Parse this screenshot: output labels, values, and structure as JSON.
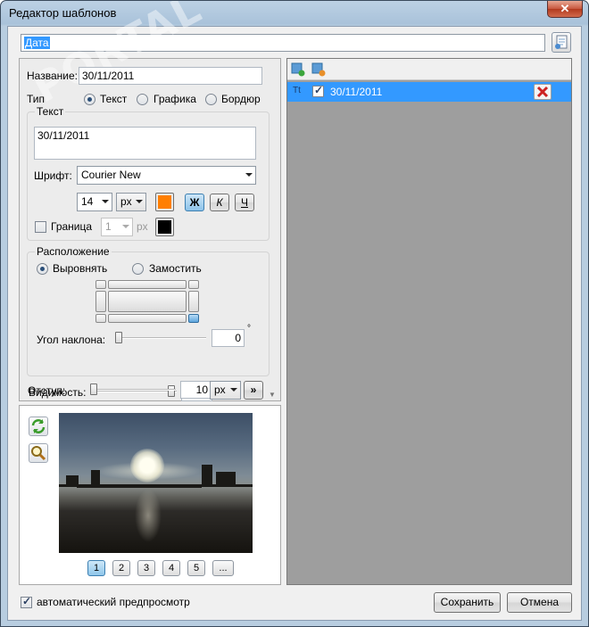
{
  "window": {
    "title": "Редактор шаблонов",
    "close_symbol": "✕"
  },
  "template_name": "Дата",
  "watermark": "PORTAL",
  "name_field": {
    "label": "Название:",
    "value": "30/11/2011"
  },
  "type": {
    "label": "Тип",
    "options": [
      "Текст",
      "Графика",
      "Бордюр"
    ],
    "selected": "Текст"
  },
  "text_group": {
    "label": "Текст",
    "value": "30/11/2011",
    "font_label": "Шрифт:",
    "font": "Courier New",
    "size": "14",
    "unit": "px",
    "color": "#ff7f00",
    "bold": "Ж",
    "italic": "К",
    "underline": "Ч",
    "border_label": "Граница",
    "border_size": "1",
    "border_unit": "px",
    "border_color": "#000000"
  },
  "position_group": {
    "label": "Расположение",
    "options": [
      "Выровнять",
      "Замостить"
    ],
    "selected": "Выровнять",
    "angle_label": "Угол наклона:",
    "angle_value": "0",
    "angle_unit": "°"
  },
  "visibility": {
    "label": "Видимость:",
    "value": "100",
    "unit": "%"
  },
  "indent": {
    "label": "Отступ:",
    "value": "10",
    "unit": "px",
    "more": "»"
  },
  "pages": [
    "1",
    "2",
    "3",
    "4",
    "5",
    "..."
  ],
  "selected_page": "1",
  "layers": [
    {
      "name": "30/11/2011",
      "checked": true,
      "type_icon": "Tt"
    }
  ],
  "auto_preview": {
    "label": "автоматический предпросмотр",
    "checked": true
  },
  "buttons": {
    "save": "Сохранить",
    "cancel": "Отмена"
  },
  "colors": {
    "accent": "#3399ff",
    "layer_bg": "#9e9e9e",
    "delete": "#cc2222"
  }
}
